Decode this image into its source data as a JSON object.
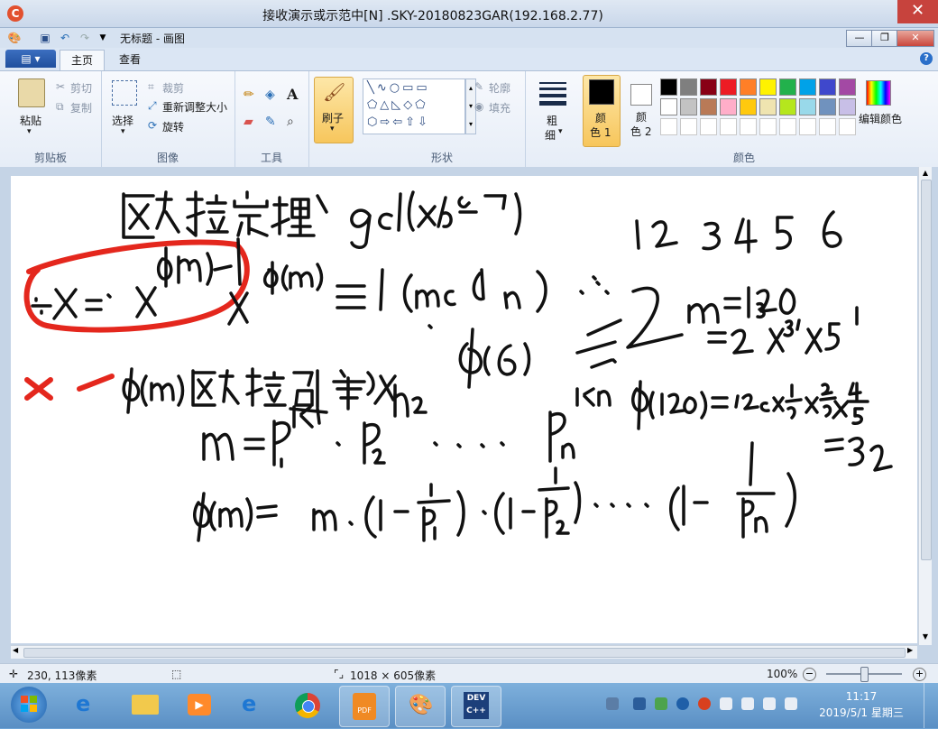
{
  "remote_window": {
    "title": "接收演示或示范中[N] .SKY-20180823GAR(192.168.2.77)",
    "close": "✕"
  },
  "paint_window": {
    "title": "无标题 - 画图",
    "min": "—",
    "max": "❐",
    "close": "✕"
  },
  "tabs": {
    "file": "▤ ▾",
    "home": "主页",
    "view": "查看",
    "help": "?"
  },
  "clipboard": {
    "paste": "粘贴",
    "cut": "剪切",
    "copy": "复制",
    "group": "剪贴板"
  },
  "image": {
    "select": "选择",
    "crop": "裁剪",
    "resize": "重新调整大小",
    "rotate": "旋转",
    "group": "图像"
  },
  "tools": {
    "group": "工具",
    "text": "A"
  },
  "brushes": {
    "label": "刷子"
  },
  "shapes": {
    "outline": "轮廓",
    "fill": "填充",
    "group": "形状"
  },
  "size": {
    "label1": "粗",
    "label2": "细"
  },
  "colors": {
    "color1_l1": "颜",
    "color1_l2": "色 1",
    "color2_l1": "颜",
    "color2_l2": "色 2",
    "edit": "编辑颜色",
    "group": "颜色",
    "color1": "#000000",
    "color2": "#ffffff",
    "palette_row1": [
      "#000000",
      "#7f7f7f",
      "#880015",
      "#ed1c24",
      "#ff7f27",
      "#fff200",
      "#22b14c",
      "#00a2e8",
      "#3f48cc",
      "#a349a4"
    ],
    "palette_row2": [
      "#ffffff",
      "#c3c3c3",
      "#b97a57",
      "#ffaec9",
      "#ffc90e",
      "#efe4b0",
      "#b5e61d",
      "#99d9ea",
      "#7092be",
      "#c8bfe7"
    ]
  },
  "status": {
    "cursor": "230, 113像素",
    "size": "1018 × 605像素",
    "zoom": "100%"
  },
  "clock": {
    "time": "11:17",
    "date": "2019/5/1 星期三"
  }
}
